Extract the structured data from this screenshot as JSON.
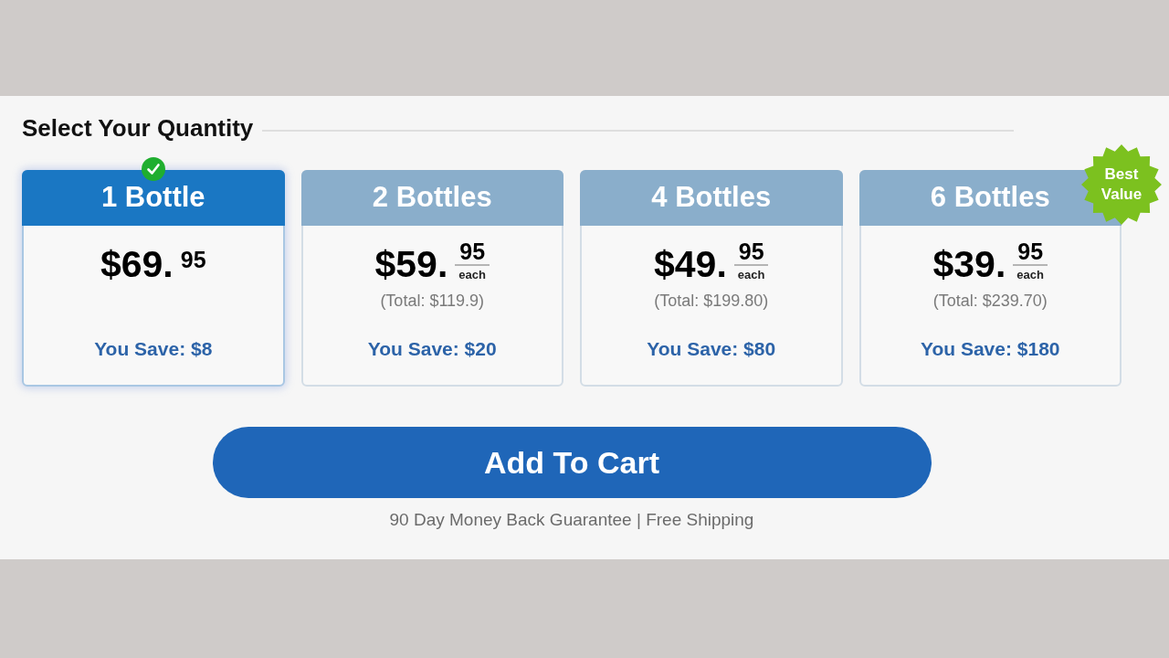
{
  "heading": "Select Your Quantity",
  "options": [
    {
      "label": "1 Bottle",
      "selected": true,
      "price_dollars": "$69.",
      "price_cents": "95",
      "savings": "You Save: $8"
    },
    {
      "label": "2 Bottles",
      "selected": false,
      "price_dollars": "$59.",
      "price_cents": "95",
      "per_unit": "each",
      "total": "(Total: $119.9)",
      "savings": "You Save: $20"
    },
    {
      "label": "4 Bottles",
      "selected": false,
      "price_dollars": "$49.",
      "price_cents": "95",
      "per_unit": "each",
      "total": "(Total: $199.80)",
      "savings": "You Save: $80"
    },
    {
      "label": "6 Bottles",
      "selected": false,
      "price_dollars": "$39.",
      "price_cents": "95",
      "per_unit": "each",
      "total": "(Total: $239.70)",
      "savings": "You Save: $180",
      "badge": "Best Value"
    }
  ],
  "add_to_cart_button": "Add To Cart",
  "guarantee": "90 Day Money Back Guarantee | Free Shipping"
}
